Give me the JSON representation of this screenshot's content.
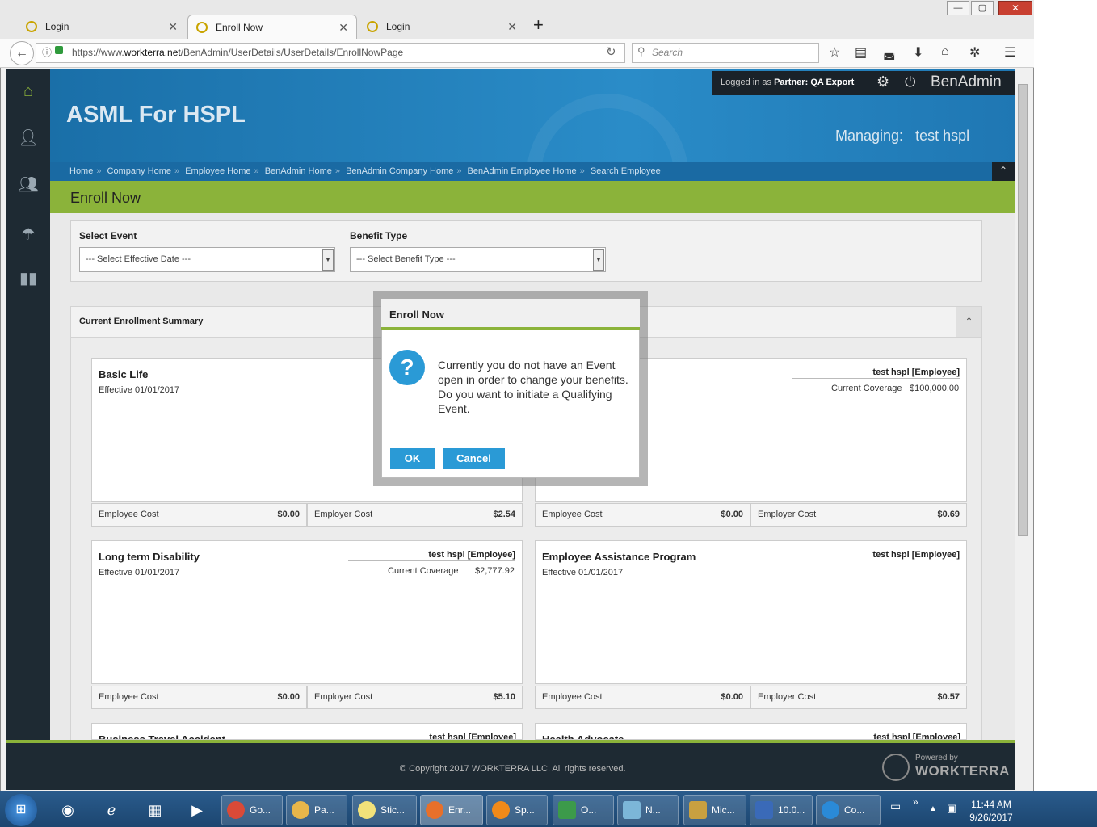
{
  "browser": {
    "tabs": [
      {
        "label": "Login"
      },
      {
        "label": "Enroll Now"
      },
      {
        "label": "Login"
      }
    ],
    "url_prefix": "https://www.",
    "url_host": "workterra.net",
    "url_path": "/BenAdmin/UserDetails/UserDetails/EnrollNowPage",
    "search_placeholder": "Search",
    "window_controls": {
      "minimize": "—",
      "maximize": "▢",
      "close": "✕"
    }
  },
  "header": {
    "app_name": "ASML For HSPL",
    "logged_in_prefix": "Logged in as",
    "logged_in_role": "Partner:",
    "logged_in_user": "QA Export",
    "brand": "BenAdmin",
    "managing_label": "Managing:",
    "managing_value": "test hspl"
  },
  "breadcrumbs": [
    "Home",
    "Company Home",
    "Employee Home",
    "BenAdmin Home",
    "BenAdmin Company Home",
    "BenAdmin Employee Home",
    "Search Employee"
  ],
  "page": {
    "title": "Enroll Now",
    "select_event_label": "Select Event",
    "select_event_value": "--- Select Effective Date ---",
    "benefit_type_label": "Benefit Type",
    "benefit_type_value": "--- Select Benefit Type ---",
    "summary_title": "Current Enrollment Summary"
  },
  "cards": [
    {
      "title": "Basic Life",
      "effective": "Effective 01/01/2017",
      "owner": "",
      "coverage_label": "",
      "coverage_value": "",
      "employee_cost_label": "Employee Cost",
      "employee_cost": "$0.00",
      "employer_cost_label": "Employer Cost",
      "employer_cost": "$2.54"
    },
    {
      "title": "",
      "effective": "",
      "owner": "test hspl [Employee]",
      "coverage_label": "Current Coverage",
      "coverage_value": "$100,000.00",
      "employee_cost_label": "Employee Cost",
      "employee_cost": "$0.00",
      "employer_cost_label": "Employer Cost",
      "employer_cost": "$0.69"
    },
    {
      "title": "Long term Disability",
      "effective": "Effective 01/01/2017",
      "owner": "test hspl [Employee]",
      "coverage_label": "Current Coverage",
      "coverage_value": "$2,777.92",
      "employee_cost_label": "Employee Cost",
      "employee_cost": "$0.00",
      "employer_cost_label": "Employer Cost",
      "employer_cost": "$5.10"
    },
    {
      "title": "Employee Assistance Program",
      "effective": "Effective 01/01/2017",
      "owner": "test hspl [Employee]",
      "coverage_label": "",
      "coverage_value": "",
      "employee_cost_label": "Employee Cost",
      "employee_cost": "$0.00",
      "employer_cost_label": "Employer Cost",
      "employer_cost": "$0.57"
    },
    {
      "title": "Business Travel Accident",
      "owner": "test hspl [Employee]"
    },
    {
      "title": "Health Advocate",
      "owner": "test hspl [Employee]"
    }
  ],
  "modal": {
    "title": "Enroll Now",
    "message": "Currently you do not have an Event open in order to change your benefits. Do you want to initiate a Qualifying Event.",
    "ok_label": "OK",
    "cancel_label": "Cancel"
  },
  "footer": {
    "copyright": "© Copyright 2017 WORKTERRA LLC. All rights reserved.",
    "powered_by": "Powered by",
    "powered_brand": "WORKTERRA"
  },
  "taskbar": {
    "items": [
      {
        "label": "Go..."
      },
      {
        "label": "Pa..."
      },
      {
        "label": "Stic..."
      },
      {
        "label": "Enr..."
      },
      {
        "label": "Sp..."
      },
      {
        "label": "O..."
      },
      {
        "label": "N..."
      },
      {
        "label": "Mic..."
      },
      {
        "label": "10.0..."
      },
      {
        "label": "Co..."
      }
    ],
    "time": "11:44 AM",
    "date": "9/26/2017",
    "colors": {
      "accent": "#8bb33a",
      "primary_button": "#2a9ad6",
      "banner": "#1f77b3"
    }
  }
}
